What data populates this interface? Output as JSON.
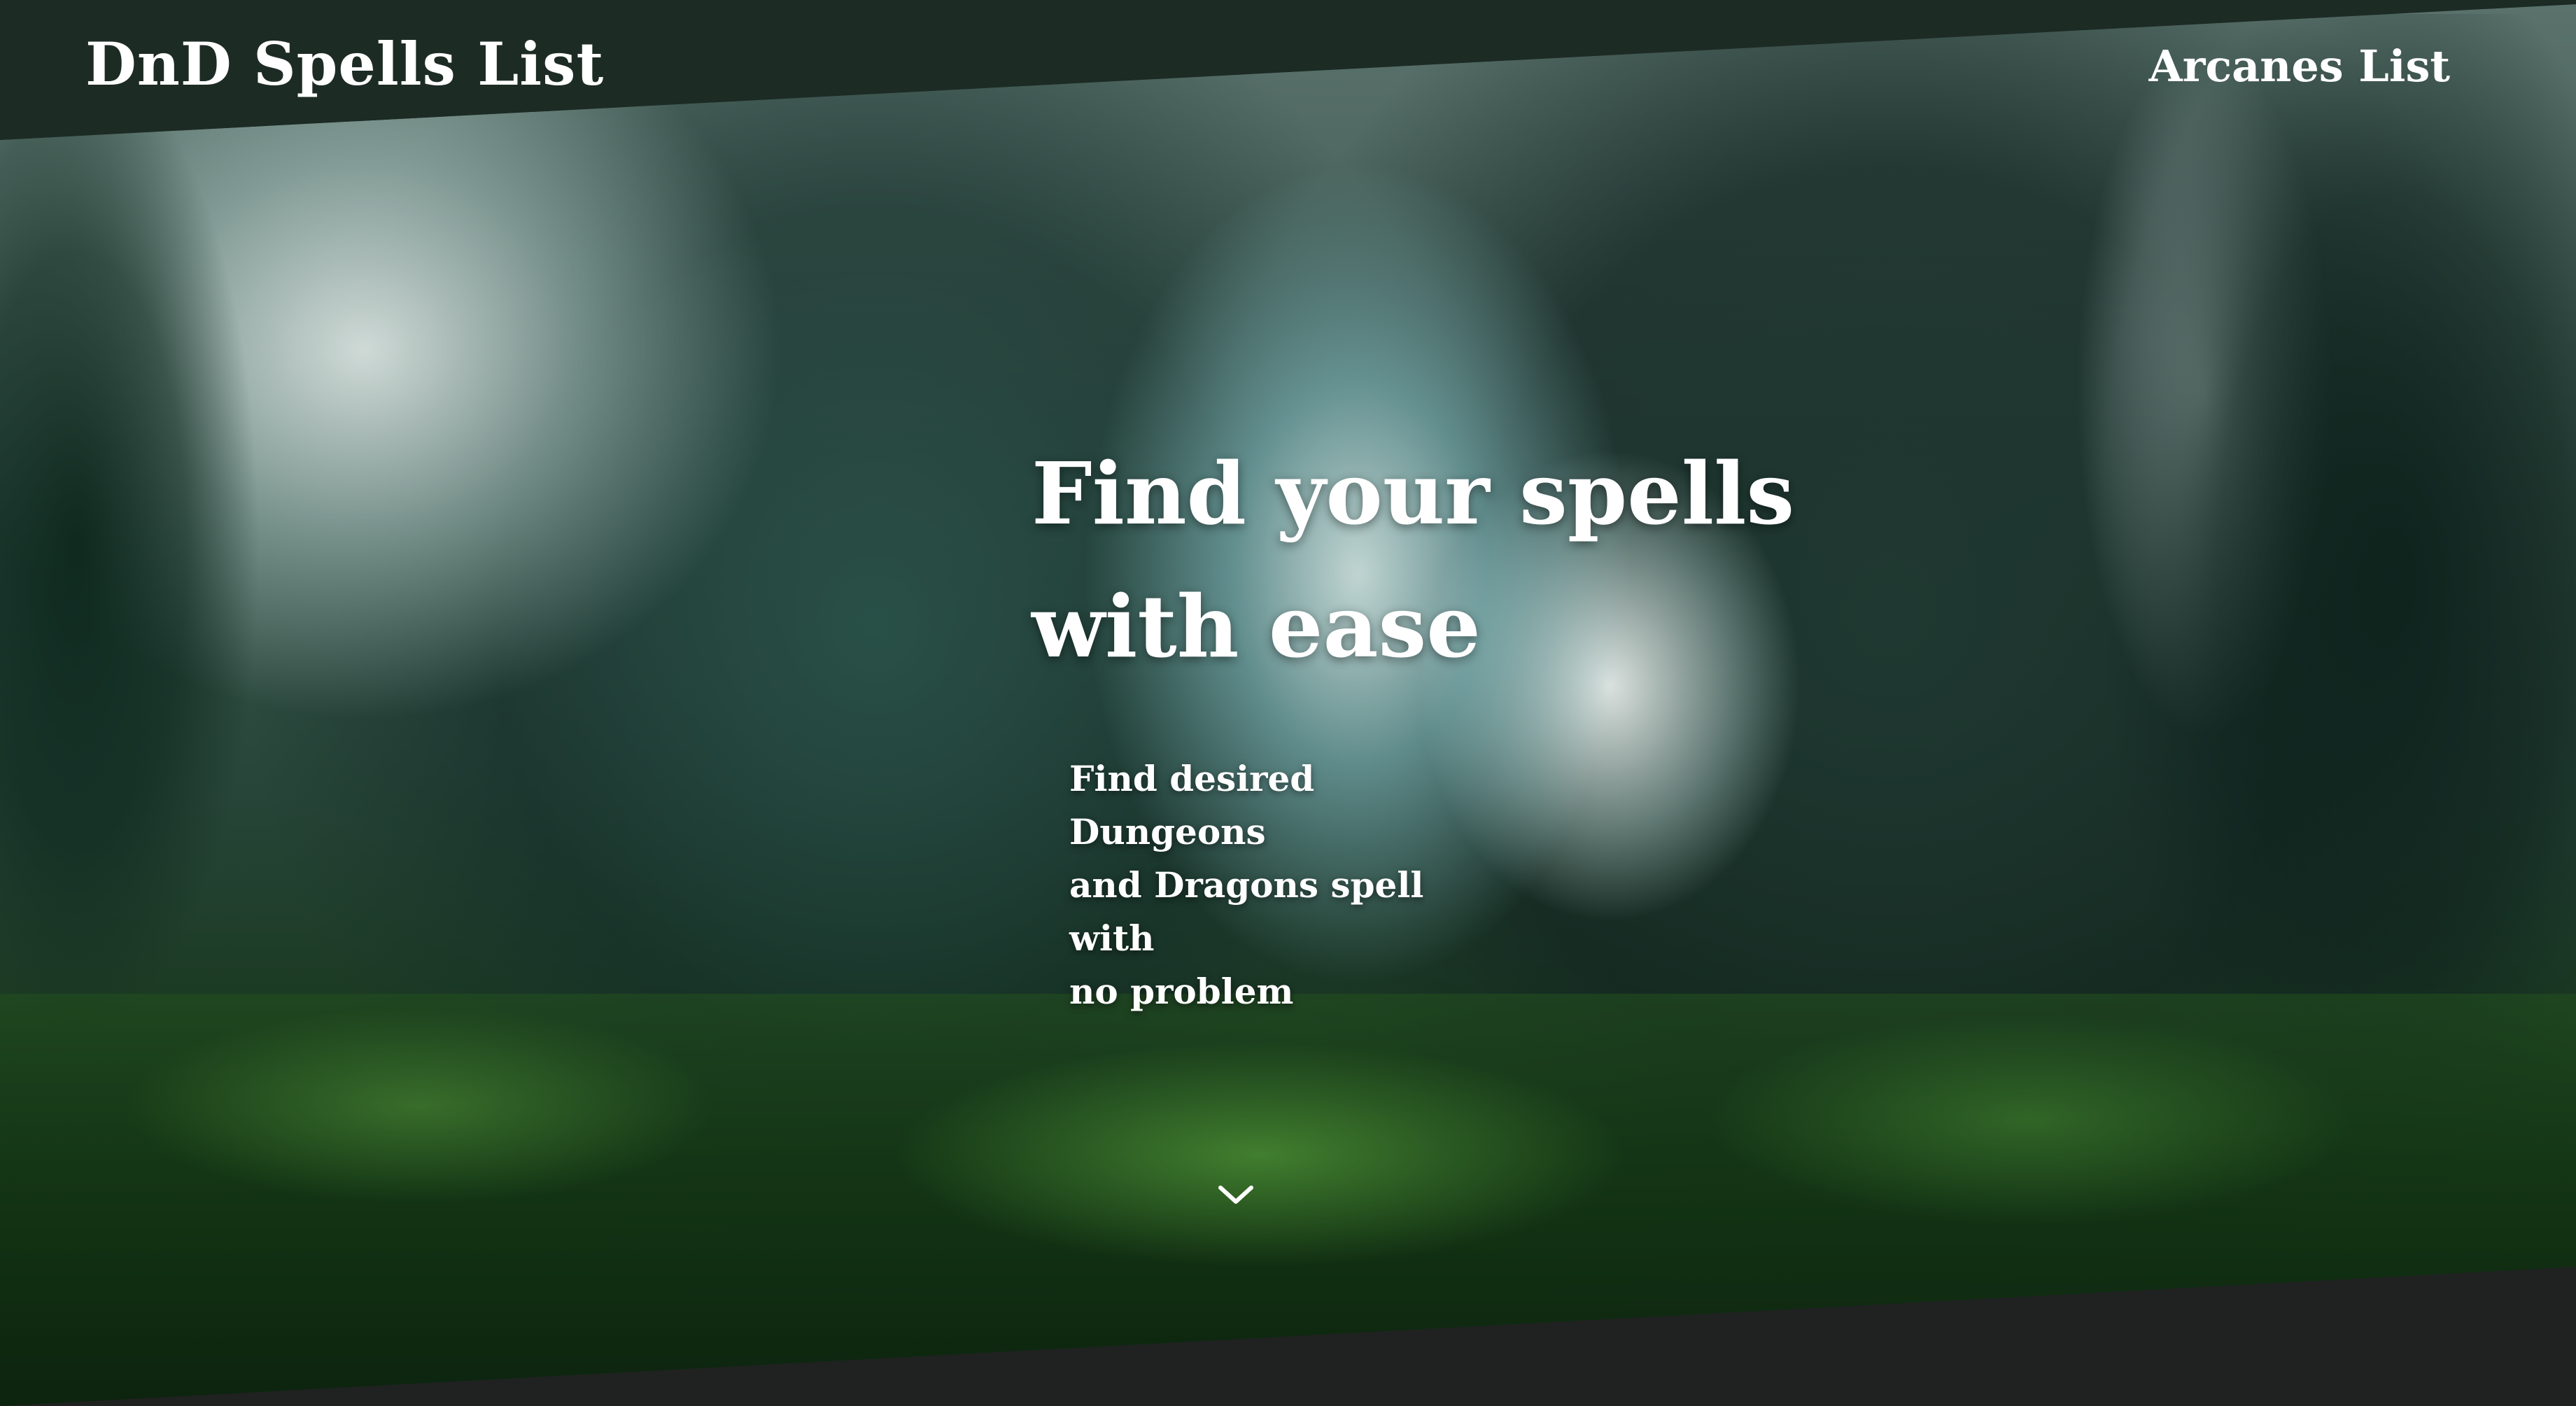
{
  "header": {
    "brand": "DnD Spells List",
    "nav_link": "Arcanes List"
  },
  "hero": {
    "title_line1": "Find your spells",
    "title_line2": "with ease",
    "subtitle_line1": "Find desired Dungeons",
    "subtitle_line2": "and Dragons spell with",
    "subtitle_line3": "no problem",
    "background_image": "enchanted forest with twisted tree arch",
    "scroll_icon": "chevron-down-icon"
  },
  "colors": {
    "header_bg": "#1d2b25",
    "footer_bg": "#1f2221",
    "text": "#ffffff"
  }
}
